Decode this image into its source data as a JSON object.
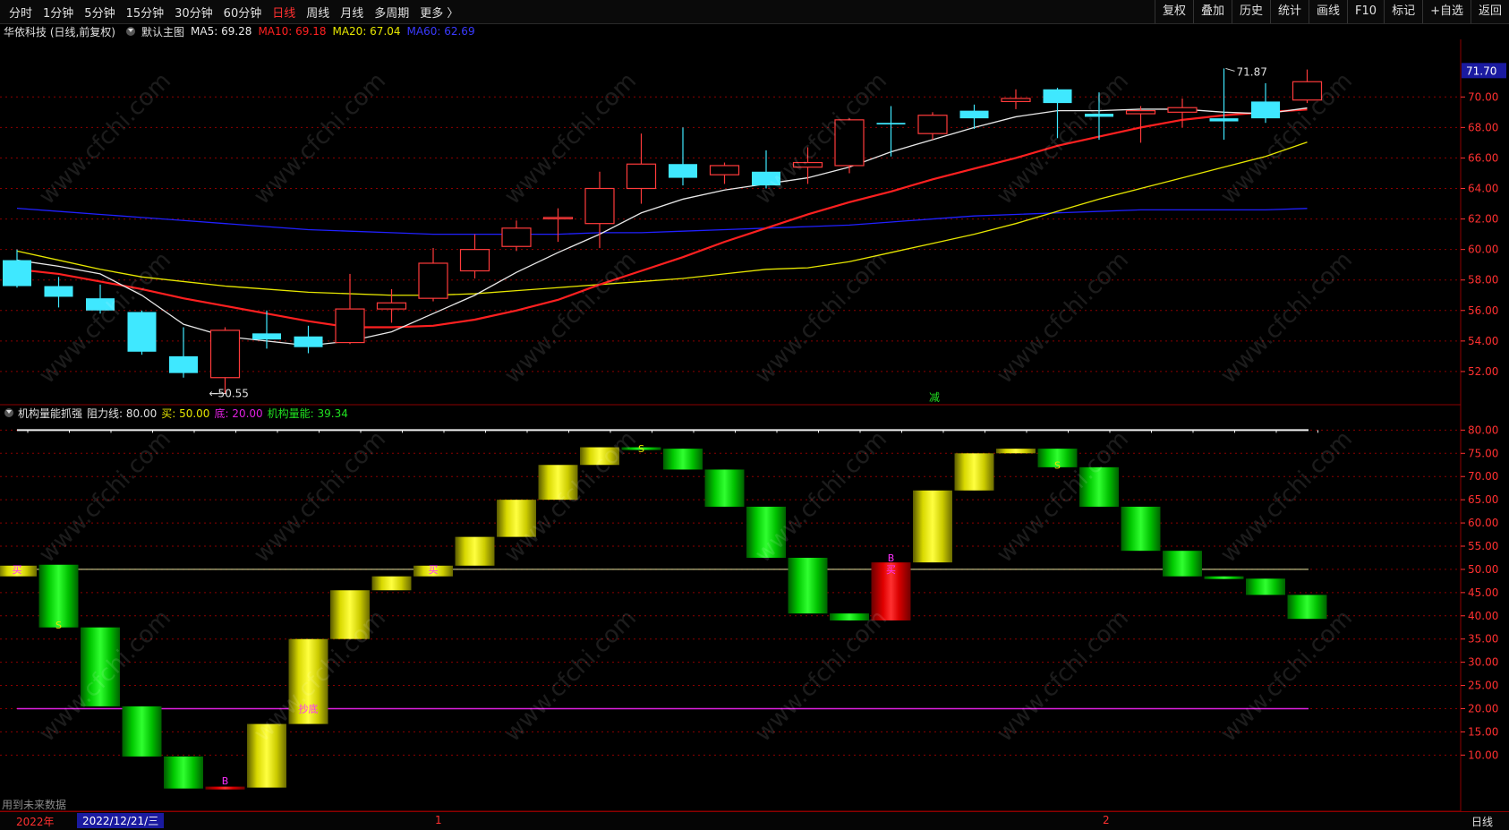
{
  "topbar": {
    "tabs": [
      "分时",
      "1分钟",
      "5分钟",
      "15分钟",
      "30分钟",
      "60分钟",
      "日线",
      "周线",
      "月线",
      "多周期",
      "更多 〉"
    ],
    "active_tab": "日线",
    "tools": [
      "复权",
      "叠加",
      "历史",
      "统计",
      "画线",
      "F10",
      "标记",
      "+自选",
      "返回"
    ]
  },
  "info": {
    "stock": "华依科技 (日线,前复权)",
    "main_chart": "默认主图",
    "ma5": "MA5: 69.28",
    "ma10": "MA10: 69.18",
    "ma20": "MA20: 67.04",
    "ma60": "MA60: 62.69"
  },
  "sub_info": {
    "name": "机构量能抓强",
    "resist": "阻力线: 80.00",
    "buy": "买: 50.00",
    "bottom": "底: 20.00",
    "energy": "机构量能: 39.34"
  },
  "colors": {
    "up": "#ff3b3b",
    "down": "#3fe8ff",
    "ma5": "#e8e8e8",
    "ma10": "#ff2020",
    "ma20": "#e6e600",
    "ma60": "#2020ff",
    "grid": "#8b0000",
    "axis": "#ff3030",
    "purple": "#e020e0"
  },
  "chart_data": [
    {
      "type": "candlestick",
      "title": "华依科技 (日线,前复权)",
      "ylim": [
        50.5,
        72.5
      ],
      "y_ticks": [
        "52.00",
        "54.00",
        "56.00",
        "58.00",
        "60.00",
        "62.00",
        "64.00",
        "66.00",
        "68.00",
        "70.00"
      ],
      "current_price": "71.70",
      "high_label": "71.87",
      "low_label": "50.55",
      "candles": [
        {
          "o": 59.3,
          "c": 57.6,
          "h": 60.0,
          "l": 57.5
        },
        {
          "o": 57.6,
          "c": 56.9,
          "h": 58.2,
          "l": 56.2
        },
        {
          "o": 56.8,
          "c": 56.0,
          "h": 57.7,
          "l": 55.8
        },
        {
          "o": 55.9,
          "c": 53.3,
          "h": 56.0,
          "l": 53.1
        },
        {
          "o": 53.0,
          "c": 51.9,
          "h": 54.9,
          "l": 51.6
        },
        {
          "o": 51.6,
          "c": 54.7,
          "h": 54.9,
          "l": 50.55
        },
        {
          "o": 54.5,
          "c": 54.1,
          "h": 56.0,
          "l": 53.5
        },
        {
          "o": 54.3,
          "c": 53.6,
          "h": 55.0,
          "l": 53.2
        },
        {
          "o": 53.9,
          "c": 56.1,
          "h": 58.4,
          "l": 53.8
        },
        {
          "o": 56.1,
          "c": 56.5,
          "h": 57.4,
          "l": 55.2
        },
        {
          "o": 56.8,
          "c": 59.1,
          "h": 60.1,
          "l": 56.6
        },
        {
          "o": 58.6,
          "c": 60.0,
          "h": 61.0,
          "l": 58.1
        },
        {
          "o": 60.2,
          "c": 61.4,
          "h": 61.9,
          "l": 59.9
        },
        {
          "o": 62.1,
          "c": 62.1,
          "h": 62.7,
          "l": 60.5
        },
        {
          "o": 61.7,
          "c": 64.0,
          "h": 65.1,
          "l": 60.1
        },
        {
          "o": 64.0,
          "c": 65.6,
          "h": 67.6,
          "l": 63.0
        },
        {
          "o": 65.6,
          "c": 64.7,
          "h": 68.0,
          "l": 64.2
        },
        {
          "o": 64.9,
          "c": 65.5,
          "h": 65.7,
          "l": 64.3
        },
        {
          "o": 65.1,
          "c": 64.2,
          "h": 66.5,
          "l": 64.0
        },
        {
          "o": 65.4,
          "c": 65.7,
          "h": 66.7,
          "l": 64.3
        },
        {
          "o": 65.5,
          "c": 68.5,
          "h": 68.6,
          "l": 65.0
        },
        {
          "o": 68.3,
          "c": 68.2,
          "h": 69.4,
          "l": 66.1
        },
        {
          "o": 67.6,
          "c": 68.8,
          "h": 69.0,
          "l": 67.2
        },
        {
          "o": 69.1,
          "c": 68.6,
          "h": 69.5,
          "l": 67.9
        },
        {
          "o": 69.7,
          "c": 69.9,
          "h": 70.5,
          "l": 69.2
        },
        {
          "o": 70.5,
          "c": 69.6,
          "h": 70.6,
          "l": 67.3
        },
        {
          "o": 68.9,
          "c": 68.7,
          "h": 70.3,
          "l": 67.2
        },
        {
          "o": 68.9,
          "c": 69.1,
          "h": 69.4,
          "l": 67.0
        },
        {
          "o": 69.0,
          "c": 69.3,
          "h": 69.9,
          "l": 68.0
        },
        {
          "o": 68.6,
          "c": 68.4,
          "h": 71.87,
          "l": 67.2
        },
        {
          "o": 69.7,
          "c": 68.6,
          "h": 70.9,
          "l": 68.3
        },
        {
          "o": 69.8,
          "c": 71.0,
          "h": 71.8,
          "l": 69.6
        }
      ],
      "ma5": [
        59.3,
        58.9,
        58.4,
        57.0,
        55.1,
        54.3,
        54.0,
        53.7,
        54.0,
        54.6,
        55.8,
        57.0,
        58.5,
        59.8,
        61.0,
        62.4,
        63.3,
        63.9,
        64.3,
        64.7,
        65.4,
        66.4,
        67.2,
        68.0,
        68.7,
        69.1,
        69.1,
        69.2,
        69.2,
        69.0,
        68.9,
        69.28
      ],
      "ma10": [
        58.7,
        58.4,
        57.9,
        57.4,
        56.8,
        56.3,
        55.8,
        55.3,
        54.9,
        54.9,
        55.0,
        55.4,
        56.0,
        56.7,
        57.7,
        58.6,
        59.5,
        60.5,
        61.4,
        62.3,
        63.1,
        63.8,
        64.6,
        65.3,
        66.0,
        66.8,
        67.4,
        68.0,
        68.5,
        68.8,
        69.0,
        69.18
      ],
      "ma20": [
        59.9,
        59.3,
        58.7,
        58.2,
        57.9,
        57.6,
        57.4,
        57.2,
        57.1,
        57.0,
        57.0,
        57.1,
        57.3,
        57.5,
        57.7,
        57.9,
        58.1,
        58.4,
        58.7,
        58.8,
        59.2,
        59.8,
        60.4,
        61.0,
        61.7,
        62.5,
        63.3,
        64.0,
        64.7,
        65.4,
        66.1,
        67.04
      ],
      "ma60": [
        62.7,
        62.5,
        62.3,
        62.1,
        61.9,
        61.7,
        61.5,
        61.3,
        61.2,
        61.1,
        61.0,
        61.0,
        61.0,
        61.0,
        61.1,
        61.1,
        61.2,
        61.3,
        61.4,
        61.5,
        61.6,
        61.8,
        62.0,
        62.2,
        62.3,
        62.4,
        62.5,
        62.6,
        62.6,
        62.6,
        62.6,
        62.69
      ]
    },
    {
      "type": "bar",
      "title": "机构量能抓强",
      "ylim": [
        7,
        82
      ],
      "y_ticks": [
        "10.00",
        "15.00",
        "20.00",
        "25.00",
        "30.00",
        "35.00",
        "40.00",
        "45.00",
        "50.00",
        "55.00",
        "60.00",
        "65.00",
        "70.00",
        "75.00",
        "80.00"
      ],
      "lines": {
        "resist": 80,
        "buy": 50,
        "bottom": 20
      },
      "bars": [
        {
          "from": 48.5,
          "to": 50.8,
          "color": "yellow"
        },
        {
          "from": 51.0,
          "to": 37.5,
          "color": "green"
        },
        {
          "from": 37.5,
          "to": 20.5,
          "color": "green"
        },
        {
          "from": 20.5,
          "to": 9.7,
          "color": "green"
        },
        {
          "from": 9.7,
          "to": 2.8,
          "color": "green"
        },
        {
          "from": 2.6,
          "to": 3.2,
          "color": "red"
        },
        {
          "from": 3.0,
          "to": 16.7,
          "color": "yellow"
        },
        {
          "from": 16.7,
          "to": 35.0,
          "color": "yellow"
        },
        {
          "from": 35.0,
          "to": 45.5,
          "color": "yellow"
        },
        {
          "from": 45.5,
          "to": 48.5,
          "color": "yellow"
        },
        {
          "from": 48.5,
          "to": 50.8,
          "color": "yellow"
        },
        {
          "from": 50.8,
          "to": 57.0,
          "color": "yellow"
        },
        {
          "from": 57.0,
          "to": 65.0,
          "color": "yellow"
        },
        {
          "from": 65.0,
          "to": 72.5,
          "color": "yellow"
        },
        {
          "from": 72.5,
          "to": 76.3,
          "color": "yellow"
        },
        {
          "from": 76.3,
          "to": 75.8,
          "color": "green"
        },
        {
          "from": 76.0,
          "to": 71.5,
          "color": "green"
        },
        {
          "from": 71.5,
          "to": 63.5,
          "color": "green"
        },
        {
          "from": 63.5,
          "to": 52.5,
          "color": "green"
        },
        {
          "from": 52.5,
          "to": 40.5,
          "color": "green"
        },
        {
          "from": 40.5,
          "to": 39.0,
          "color": "green"
        },
        {
          "from": 39.0,
          "to": 51.5,
          "color": "red"
        },
        {
          "from": 51.5,
          "to": 67.0,
          "color": "yellow"
        },
        {
          "from": 67.0,
          "to": 75.0,
          "color": "yellow"
        },
        {
          "from": 75.0,
          "to": 76.0,
          "color": "yellow"
        },
        {
          "from": 76.0,
          "to": 72.0,
          "color": "green"
        },
        {
          "from": 72.0,
          "to": 63.5,
          "color": "green"
        },
        {
          "from": 63.5,
          "to": 54.0,
          "color": "green"
        },
        {
          "from": 54.0,
          "to": 48.5,
          "color": "green"
        },
        {
          "from": 48.5,
          "to": 48.0,
          "color": "green"
        },
        {
          "from": 48.0,
          "to": 44.5,
          "color": "green"
        },
        {
          "from": 44.5,
          "to": 39.34,
          "color": "green"
        }
      ],
      "signals": [
        {
          "i": 0,
          "text": "买",
          "color": "#ff30ff",
          "v": 50.0
        },
        {
          "i": 1,
          "text": "S",
          "color": "#e6e600",
          "v": 38.0
        },
        {
          "i": 5,
          "text": "B",
          "color": "#ff30ff",
          "v": 4.5
        },
        {
          "i": 7,
          "text": "抄底",
          "color": "#ff30ff",
          "v": 20.0
        },
        {
          "i": 10,
          "text": "买",
          "color": "#ff30ff",
          "v": 50.0
        },
        {
          "i": 15,
          "text": "S",
          "color": "#e6e600",
          "v": 76.0
        },
        {
          "i": 21,
          "text": "B",
          "color": "#ff30ff",
          "v": 52.5
        },
        {
          "i": 21,
          "text": "买",
          "color": "#ff30ff",
          "v": 50.0
        },
        {
          "i": 25,
          "text": "S",
          "color": "#e6e600",
          "v": 72.5
        }
      ],
      "label_jian": "减"
    }
  ],
  "bottom": {
    "year": "2022年",
    "date": "2022/12/21/三",
    "m1": "1",
    "m2": "2",
    "period": "日线",
    "future_note": "用到未来数据"
  },
  "watermark": "www.cfchi.com"
}
